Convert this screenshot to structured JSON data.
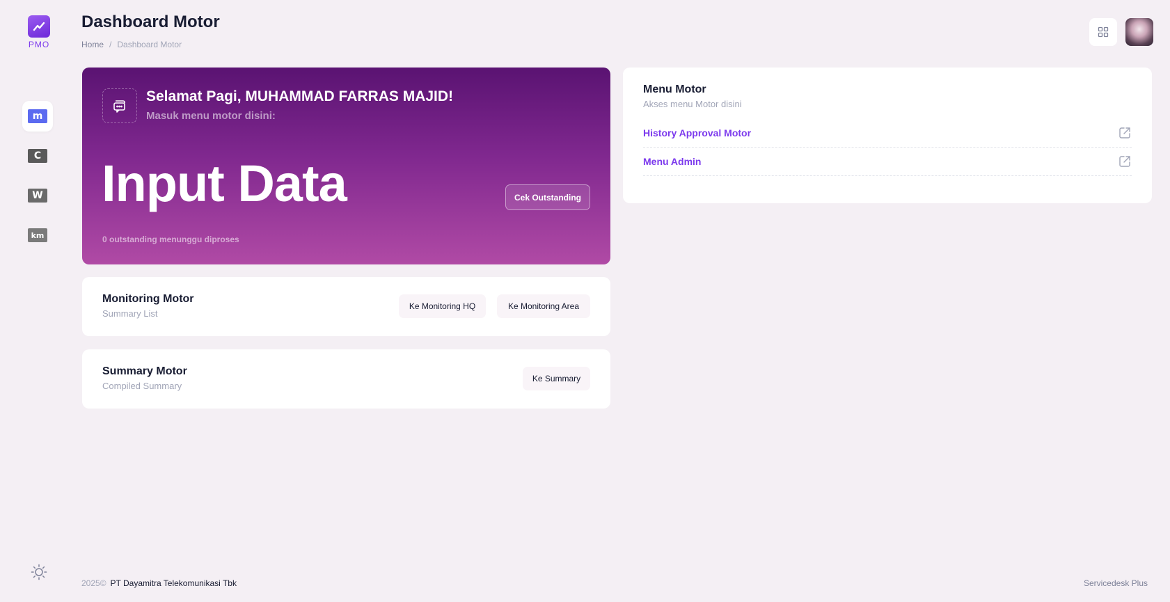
{
  "logo": {
    "text": "PMO"
  },
  "header": {
    "title": "Dashboard Motor",
    "breadcrumb": {
      "home": "Home",
      "separator": "/",
      "current": "Dashboard Motor"
    }
  },
  "sidebar": {
    "items": [
      {
        "name": "m",
        "glyph": "m",
        "color": "#5b6af0",
        "active": true
      },
      {
        "name": "c",
        "glyph": "C",
        "color": "#5a5a5a",
        "active": false
      },
      {
        "name": "w",
        "glyph": "W",
        "color": "#6a6a6a",
        "active": false
      },
      {
        "name": "km",
        "glyph": "km",
        "color": "#7a7a7a",
        "active": false
      }
    ]
  },
  "hero": {
    "greeting": "Selamat Pagi, MUHAMMAD FARRAS MAJID!",
    "subtitle": "Masuk menu motor disini:",
    "big_text": "Input Data",
    "button": "Cek Outstanding",
    "footnote": "0 outstanding menunggu diproses"
  },
  "monitoring": {
    "title": "Monitoring Motor",
    "subtitle": "Summary List",
    "btn_hq": "Ke Monitoring HQ",
    "btn_area": "Ke Monitoring Area"
  },
  "summary": {
    "title": "Summary Motor",
    "subtitle": "Compiled Summary",
    "btn": "Ke Summary"
  },
  "menu_motor": {
    "title": "Menu Motor",
    "subtitle": "Akses menu Motor disini",
    "links": [
      {
        "label": "History Approval Motor"
      },
      {
        "label": "Menu Admin"
      }
    ]
  },
  "footer": {
    "year": "2025©",
    "company": "PT Dayamitra Telekomunikasi Tbk",
    "right": "Servicedesk Plus"
  },
  "colors": {
    "accent": "#7c3aed",
    "hero_top": "#5a1372",
    "hero_bottom": "#b04aa5",
    "background": "#f4eff4"
  }
}
